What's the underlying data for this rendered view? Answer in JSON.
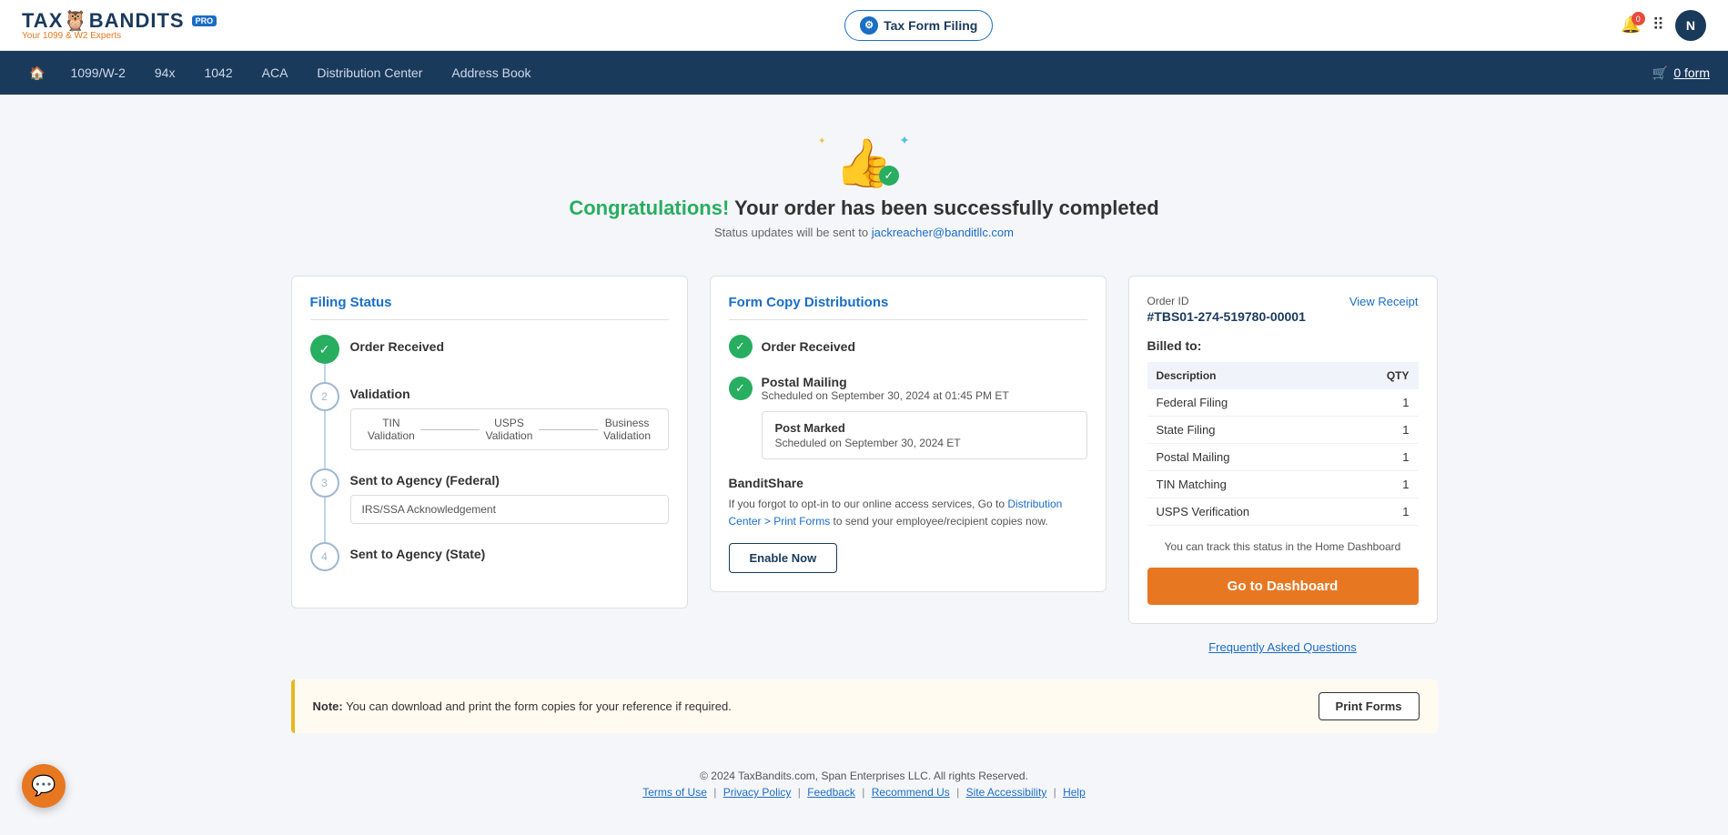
{
  "app": {
    "name": "TAX",
    "name_highlight": "BANDITS",
    "tagline": "Your 1099 & W2 Experts",
    "pro_badge": "PRO",
    "active_module": "Tax Form Filing"
  },
  "header": {
    "notification_count": "0",
    "user_initial": "N",
    "tax_form_btn_label": "Tax Form Filing",
    "cart_label": "0 form"
  },
  "nav": {
    "home_icon": "🏠",
    "items": [
      {
        "label": "1099/W-2",
        "id": "nav-1099"
      },
      {
        "label": "94x",
        "id": "nav-94x"
      },
      {
        "label": "1042",
        "id": "nav-1042"
      },
      {
        "label": "ACA",
        "id": "nav-aca"
      },
      {
        "label": "Distribution Center",
        "id": "nav-distribution"
      },
      {
        "label": "Address Book",
        "id": "nav-address"
      }
    ],
    "cart_icon": "🛒"
  },
  "congrats": {
    "title_highlight": "Congratulations!",
    "title_rest": " Your order has been successfully completed",
    "subtitle": "Status updates will be sent to",
    "email": "jackreacher@banditllc.com",
    "thumbs_icon": "👍"
  },
  "filing_status": {
    "section_title": "Filing Status",
    "steps": [
      {
        "id": 1,
        "label": "Order Received",
        "status": "completed"
      },
      {
        "id": 2,
        "label": "Validation",
        "status": "pending",
        "sub_steps": [
          "TIN Validation",
          "USPS Validation",
          "Business Validation"
        ]
      },
      {
        "id": 3,
        "label": "Sent to Agency (Federal)",
        "status": "pending",
        "sub_label": "IRS/SSA Acknowledgement"
      },
      {
        "id": 4,
        "label": "Sent to Agency (State)",
        "status": "pending"
      }
    ]
  },
  "form_copy": {
    "section_title": "Form Copy Distributions",
    "order_received_label": "Order Received",
    "postal_mailing_label": "Postal Mailing",
    "postal_mailing_date": "Scheduled on September 30, 2024 at 01:45 PM ET",
    "post_marked_title": "Post Marked",
    "post_marked_date": "Scheduled on September 30, 2024 ET",
    "banditshare_title": "BanditShare",
    "banditshare_text": "If you forgot to opt-in to our online access services, Go to Distribution Center > Print Forms to send your employee/recipient copies now.",
    "enable_btn_label": "Enable Now"
  },
  "receipt": {
    "order_id_label": "Order ID",
    "order_id_value": "#TBS01-274-519780-00001",
    "view_receipt_label": "View Receipt",
    "billed_to": "Billed to:",
    "table_headers": [
      "Description",
      "QTY"
    ],
    "line_items": [
      {
        "desc": "Federal Filing",
        "qty": "1"
      },
      {
        "desc": "State Filing",
        "qty": "1"
      },
      {
        "desc": "Postal Mailing",
        "qty": "1"
      },
      {
        "desc": "TIN Matching",
        "qty": "1"
      },
      {
        "desc": "USPS Verification",
        "qty": "1"
      }
    ],
    "track_text": "You can track this status in the Home Dashboard",
    "go_dashboard_label": "Go to Dashboard",
    "faq_label": "Frequently Asked Questions"
  },
  "note": {
    "bold": "Note:",
    "text": " You can download and print the form copies for your reference if required.",
    "print_btn_label": "Print Forms"
  },
  "footer": {
    "copyright": "© 2024 TaxBandits.com, Span Enterprises LLC. All rights Reserved.",
    "links": [
      {
        "label": "Terms of Use"
      },
      {
        "label": "Privacy Policy"
      },
      {
        "label": "Feedback"
      },
      {
        "label": "Recommend Us"
      },
      {
        "label": "Site Accessibility"
      },
      {
        "label": "Help"
      }
    ]
  },
  "chat": {
    "icon": "💬"
  }
}
